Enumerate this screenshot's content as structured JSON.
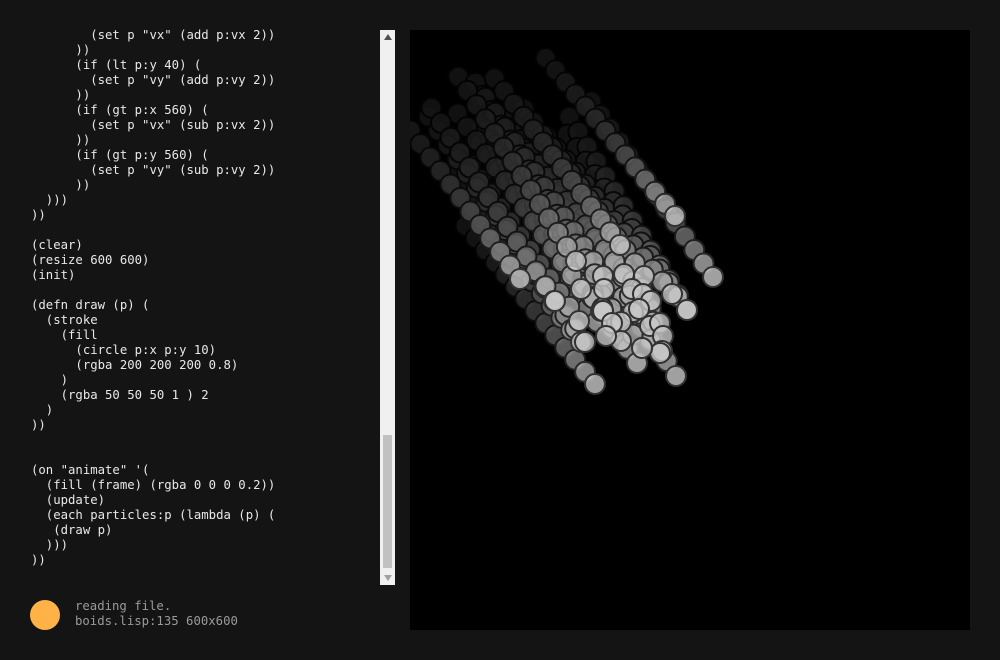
{
  "editor": {
    "code_lines": [
      "        (set p \"vx\" (add p:vx 2))",
      "      ))",
      "      (if (lt p:y 40) (",
      "        (set p \"vy\" (add p:vy 2))",
      "      ))",
      "      (if (gt p:x 560) (",
      "        (set p \"vx\" (sub p:vx 2))",
      "      ))",
      "      (if (gt p:y 560) (",
      "        (set p \"vy\" (sub p:vy 2))",
      "      ))",
      "  )))",
      "))",
      "",
      "(clear)",
      "(resize 600 600)",
      "(init)",
      "",
      "(defn draw (p) (",
      "  (stroke",
      "    (fill",
      "      (circle p:x p:y 10)",
      "      (rgba 200 200 200 0.8)",
      "    )",
      "    (rgba 50 50 50 1 ) 2",
      "  )",
      "))",
      "",
      "",
      "(on \"animate\" '(",
      "  (fill (frame) (rgba 0 0 0 0.2))",
      "  (update)",
      "  (each particles:p (lambda (p) (",
      "   (draw p)",
      "  )))",
      "))"
    ]
  },
  "status": {
    "message": "reading file.",
    "file_info": "boids.lisp:135 600x600",
    "indicator_color": "#ffb347"
  },
  "scrollbar": {
    "up_icon": "triangle-up-icon",
    "down_icon": "triangle-down-icon"
  },
  "canvas": {
    "background": "#000000",
    "particle_fill": "rgba(200,200,200,0.8)",
    "particle_stroke": "rgba(50,50,50,1)"
  }
}
